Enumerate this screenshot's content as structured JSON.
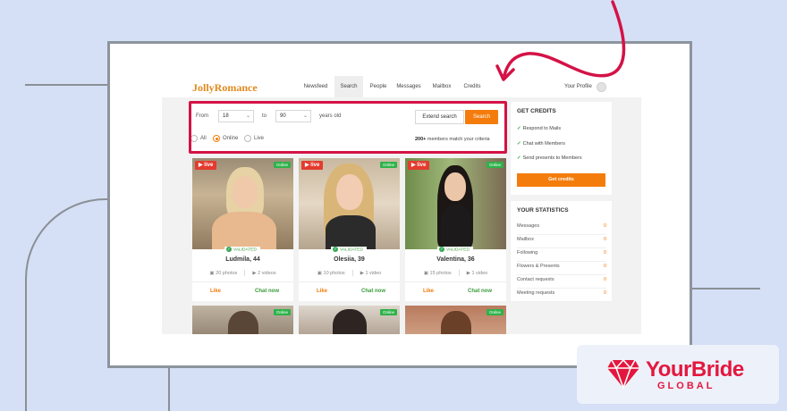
{
  "nav": {
    "logo": "JollyRomance",
    "items": [
      {
        "label": "Newsfeed"
      },
      {
        "label": "Search",
        "active": true
      },
      {
        "label": "People"
      },
      {
        "label": "Messages"
      },
      {
        "label": "Mailbox"
      },
      {
        "label": "Credits"
      }
    ],
    "profile": "Your Profile"
  },
  "search": {
    "from_label": "From",
    "from_value": "18",
    "to_label": "to",
    "to_value": "90",
    "years_label": "years old",
    "extend_label": "Extend search",
    "search_label": "Search",
    "filter_all": "All",
    "filter_online": "Online",
    "filter_live": "Live",
    "selected_filter": "Online",
    "match_count": "200+",
    "match_text": "members match your criteria"
  },
  "cards": [
    {
      "name": "Ludmila, 44",
      "photos": "20 photos",
      "videos": "2 videos",
      "live": "live",
      "online": "Online",
      "validated": "VALIDATED",
      "like": "Like",
      "chat": "Chat now"
    },
    {
      "name": "Olesiia, 39",
      "photos": "10 photos",
      "videos": "1 video",
      "live": "live",
      "online": "Online",
      "validated": "VALIDATED",
      "like": "Like",
      "chat": "Chat now"
    },
    {
      "name": "Valentina, 36",
      "photos": "15 photos",
      "videos": "1 video",
      "live": "live",
      "online": "Online",
      "validated": "VALIDATED",
      "like": "Like",
      "chat": "Chat now"
    }
  ],
  "cards_row2": [
    {
      "online": "Online"
    },
    {
      "online": "Online"
    },
    {
      "online": "Online"
    }
  ],
  "credits": {
    "title": "GET CREDITS",
    "items": [
      "Respond to Mails",
      "Chat with Members",
      "Send presents to Members"
    ],
    "button": "Get credits"
  },
  "statistics": {
    "title": "YOUR STATISTICS",
    "rows": [
      {
        "label": "Messages",
        "value": "0"
      },
      {
        "label": "Mailbox",
        "value": "0"
      },
      {
        "label": "Following",
        "value": "0"
      },
      {
        "label": "Flowers & Presents",
        "value": "0"
      },
      {
        "label": "Contact requests",
        "value": "0"
      },
      {
        "label": "Meeting requests",
        "value": "0"
      }
    ]
  },
  "brand": {
    "name": "YourBride",
    "sub": "GLOBAL"
  },
  "colors": {
    "accent": "#f47c0c",
    "highlight": "#d41246",
    "online": "#2eb24a",
    "brand": "#e3173e"
  }
}
